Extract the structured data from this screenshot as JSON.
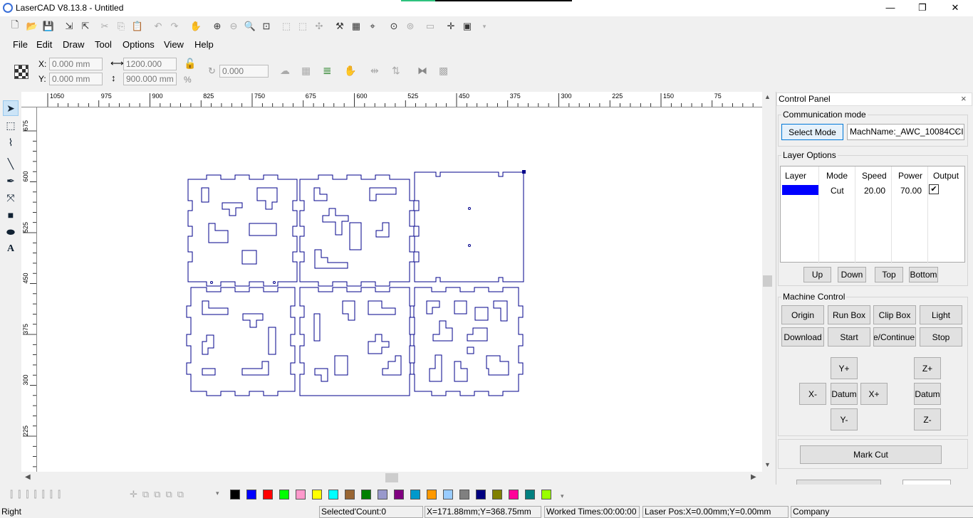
{
  "app": {
    "title": "LaserCAD V8.13.8 - Untitled"
  },
  "window": {
    "minimize": "—",
    "maximize": "❐",
    "close": "✕"
  },
  "menu": [
    "File",
    "Edit",
    "Draw",
    "Tool",
    "Options",
    "View",
    "Help"
  ],
  "position": {
    "x_label": "X:",
    "x_value": "0.000 mm",
    "y_label": "Y:",
    "y_value": "0.000 mm",
    "width_value": "1200.000 mm",
    "height_value": "900.000 mm",
    "percent": "%",
    "rotate_value": "0.000"
  },
  "ruler": {
    "top_labels": [
      "1050",
      "975",
      "900",
      "825",
      "750",
      "675",
      "600",
      "525",
      "450",
      "375",
      "300",
      "225",
      "150",
      "75"
    ],
    "left_labels": [
      "675",
      "600",
      "525",
      "450",
      "375",
      "300",
      "225"
    ]
  },
  "control_panel": {
    "title": "Control Panel",
    "communication_label": "Communication mode",
    "select_mode": "Select Mode",
    "machine_name": "MachName:_AWC_10084CCI",
    "layer_options_label": "Layer Options",
    "layer_headers": [
      "Layer",
      "Mode",
      "Speed",
      "Power",
      "Output"
    ],
    "layer_row": {
      "color": "#0000ff",
      "mode": "Cut",
      "speed": "20.00",
      "power": "70.00",
      "output": "✔"
    },
    "layer_buttons": [
      "Up",
      "Down",
      "Top",
      "Bottom"
    ],
    "machine_control_label": "Machine Control",
    "machine_buttons": [
      "Origin",
      "Run Box",
      "Clip Box",
      "Light",
      "Download",
      "Start",
      "Pause/Continue",
      "Stop"
    ],
    "jog": {
      "yplus": "Y+",
      "xminus": "X-",
      "datum": "Datum",
      "xplus": "X+",
      "yminus": "Y-",
      "zplus": "Z+",
      "zdatum": "Datum",
      "zminus": "Z-"
    },
    "mark_cut": "Mark Cut"
  },
  "palette": [
    "#000000",
    "#0000ff",
    "#ff0000",
    "#00ff00",
    "#ff99cc",
    "#ffff00",
    "#00ffff",
    "#996633",
    "#008000",
    "#9999cc",
    "#800080",
    "#0099cc",
    "#ff9900",
    "#99ccff",
    "#808080",
    "#000080",
    "#808000",
    "#ff0099",
    "#008080",
    "#99ff00"
  ],
  "status": {
    "mode": "Right",
    "selected": "Selected'Count:0",
    "coords": "X=171.88mm;Y=368.75mm",
    "worked": "Worked Times:00:00:00",
    "laser_pos": "Laser Pos:X=0.00mm;Y=0.00mm",
    "company": "Company"
  }
}
